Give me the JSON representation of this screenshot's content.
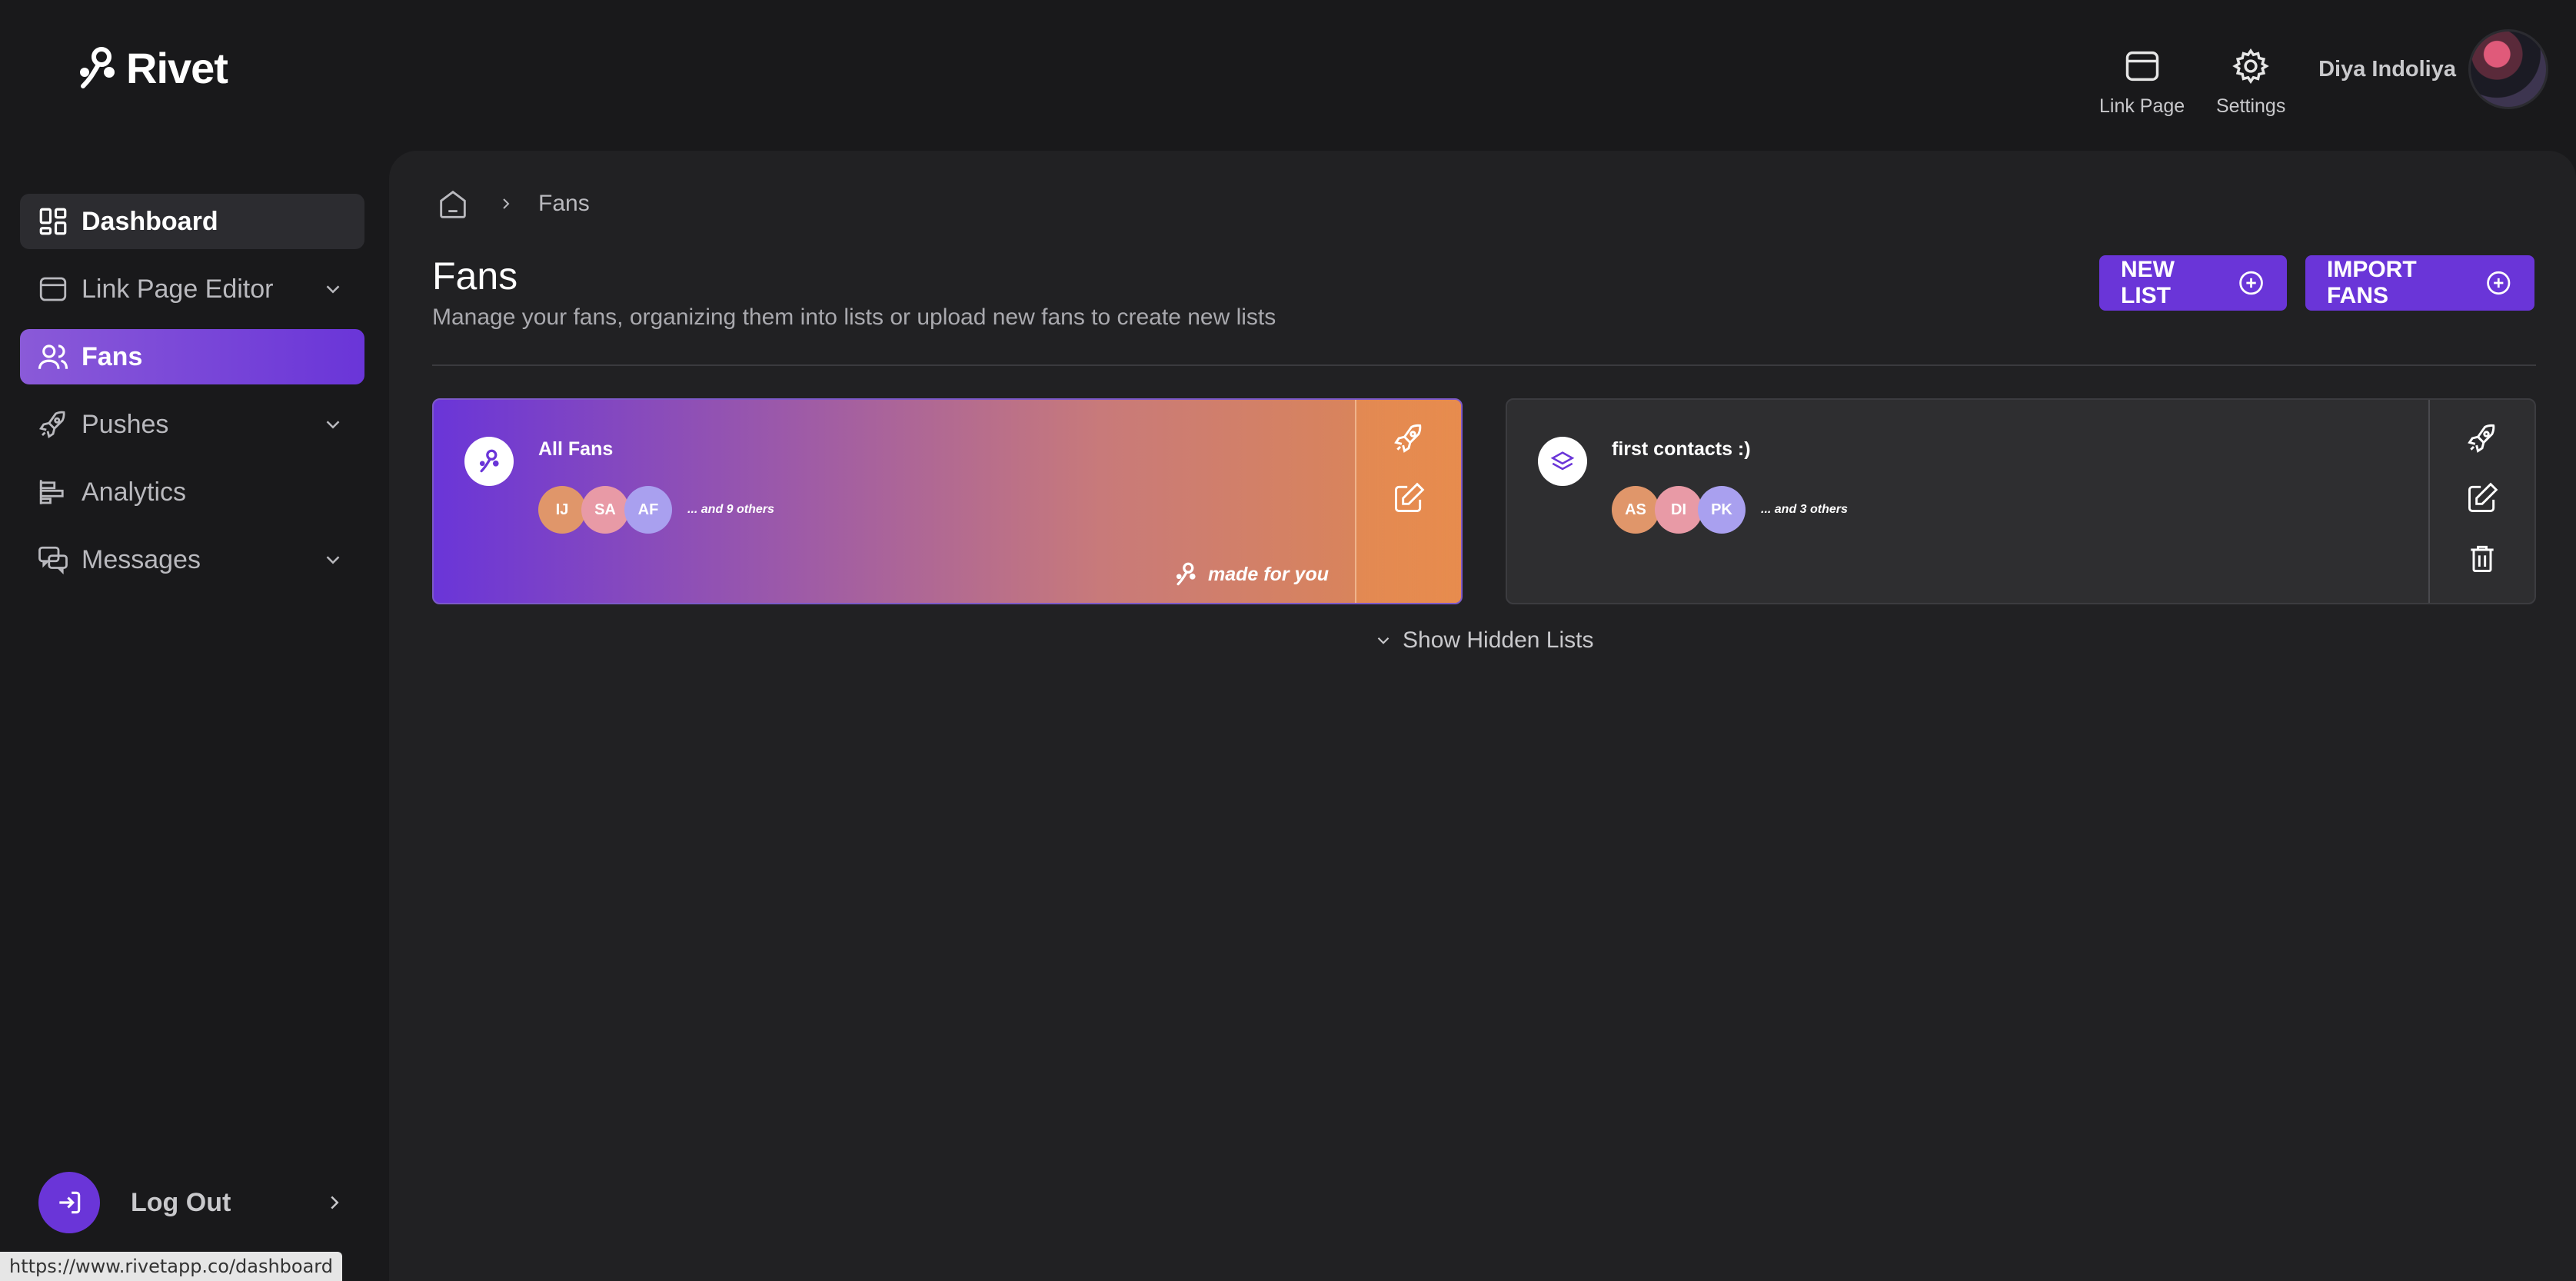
{
  "app": {
    "name": "Rivet"
  },
  "header": {
    "link_page_label": "Link Page",
    "settings_label": "Settings",
    "user_name": "Diya Indoliya"
  },
  "sidebar": {
    "items": [
      {
        "label": "Dashboard",
        "icon": "grid-icon"
      },
      {
        "label": "Link Page Editor",
        "icon": "window-icon"
      },
      {
        "label": "Fans",
        "icon": "users-icon"
      },
      {
        "label": "Pushes",
        "icon": "rocket-icon"
      },
      {
        "label": "Analytics",
        "icon": "bar-chart-icon"
      },
      {
        "label": "Messages",
        "icon": "chat-icon"
      }
    ],
    "logout_label": "Log Out"
  },
  "breadcrumb": {
    "current": "Fans"
  },
  "page": {
    "title": "Fans",
    "subtitle": "Manage your fans, organizing them into lists or upload new fans to create new lists",
    "new_list_label": "NEW LIST",
    "import_label": "IMPORT FANS",
    "show_hidden_label": "Show Hidden Lists"
  },
  "lists": [
    {
      "title": "All Fans",
      "avatars": [
        "IJ",
        "SA",
        "AF"
      ],
      "others": "... and 9 others",
      "badge": "made for you"
    },
    {
      "title": "first contacts :)",
      "avatars": [
        "AS",
        "DI",
        "PK"
      ],
      "others": "... and 3 others"
    }
  ],
  "status_url": "https://www.rivetapp.co/dashboard",
  "colors": {
    "accent": "#6a35d8",
    "background": "#19191b",
    "panel": "#212123"
  }
}
